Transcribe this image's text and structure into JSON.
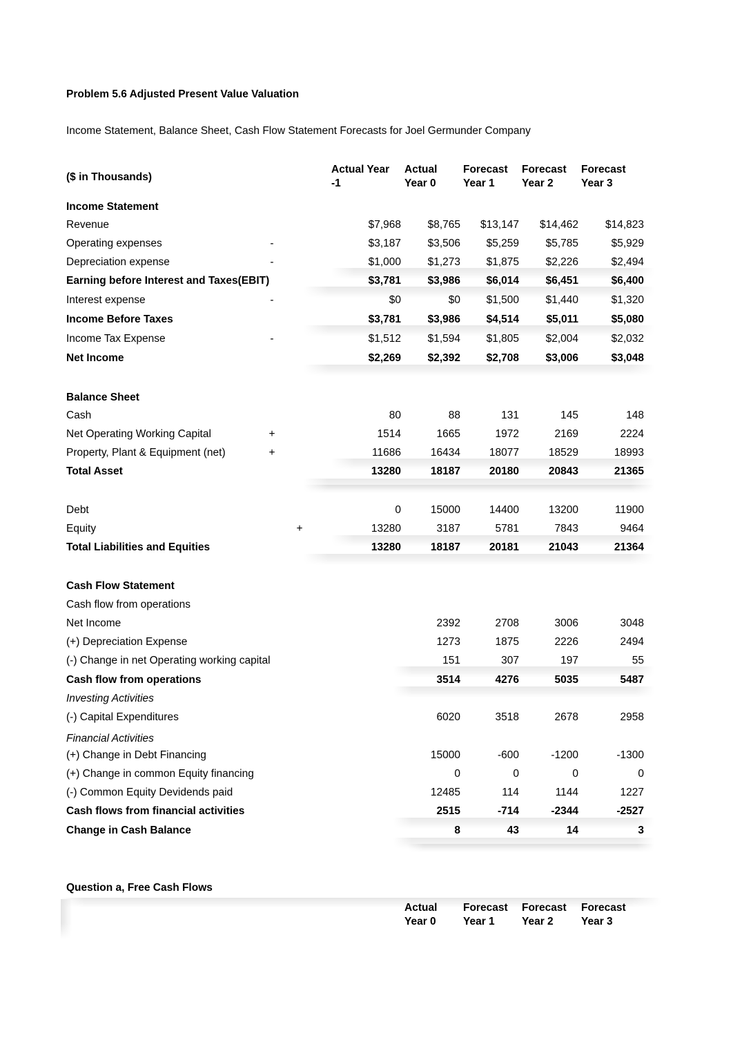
{
  "document": {
    "title": "Problem 5.6 Adjusted Present Value  Valuation",
    "subtitle": "Income Statement, Balance Sheet, Cash Flow Statement Forecasts for Joel Germunder Company",
    "units_label": "($ in Thousands)"
  },
  "column_headers": [
    {
      "top": "Actual Year",
      "bottom": "-1"
    },
    {
      "top": "Actual",
      "bottom": "Year 0"
    },
    {
      "top": "Forecast",
      "bottom": "Year 1"
    },
    {
      "top": "Forecast",
      "bottom": "Year 2"
    },
    {
      "top": "Forecast",
      "bottom": "Year 3"
    }
  ],
  "sections": {
    "income_statement": {
      "heading": "Income Statement",
      "rows": [
        {
          "label": "Revenue",
          "op": "",
          "values": [
            "$7,968",
            "$8,765",
            "$13,147",
            "$14,462",
            "$14,823"
          ],
          "bold": false
        },
        {
          "label": "Operating expenses",
          "op": "-",
          "values": [
            "$3,187",
            "$3,506",
            "$5,259",
            "$5,785",
            "$5,929"
          ],
          "bold": false
        },
        {
          "label": "Depreciation expense",
          "op": "-",
          "values": [
            "$1,000",
            "$1,273",
            "$1,875",
            "$2,226",
            "$2,494"
          ],
          "bold": false
        },
        {
          "label": "Earning before Interest and Taxes(EBIT)",
          "op": "",
          "values": [
            "$3,781",
            "$3,986",
            "$6,014",
            "$6,451",
            "$6,400"
          ],
          "bold": true
        },
        {
          "label": "Interest expense",
          "op": "-",
          "values": [
            "$0",
            "$0",
            "$1,500",
            "$1,440",
            "$1,320"
          ],
          "bold": false
        },
        {
          "label": "Income Before Taxes",
          "op": "",
          "values": [
            "$3,781",
            "$3,986",
            "$4,514",
            "$5,011",
            "$5,080"
          ],
          "bold": true
        },
        {
          "label": "Income Tax Expense",
          "op": "-",
          "values": [
            "$1,512",
            "$1,594",
            "$1,805",
            "$2,004",
            "$2,032"
          ],
          "bold": false
        },
        {
          "label": "Net Income",
          "op": "",
          "values": [
            "$2,269",
            "$2,392",
            "$2,708",
            "$3,006",
            "$3,048"
          ],
          "bold": true
        }
      ]
    },
    "balance_sheet": {
      "heading": "Balance Sheet",
      "rows": [
        {
          "label": "Cash",
          "op": "",
          "values": [
            "80",
            "88",
            "131",
            "145",
            "148"
          ],
          "bold": false
        },
        {
          "label": "Net Operating Working Capital",
          "op": "+",
          "values": [
            "1514",
            "1665",
            "1972",
            "2169",
            "2224"
          ],
          "bold": false
        },
        {
          "label": "Property, Plant & Equipment (net)",
          "op": "+",
          "values": [
            "11686",
            "16434",
            "18077",
            "18529",
            "18993"
          ],
          "bold": false
        },
        {
          "label": "Total Asset",
          "op": "",
          "values": [
            "13280",
            "18187",
            "20180",
            "20843",
            "21365"
          ],
          "bold": true
        },
        {
          "label": "Debt",
          "op": "",
          "values": [
            "0",
            "15000",
            "14400",
            "13200",
            "11900"
          ],
          "bold": false
        },
        {
          "label": "Equity",
          "op": "+",
          "values": [
            "13280",
            "3187",
            "5781",
            "7843",
            "9464"
          ],
          "bold": false
        },
        {
          "label": "Total Liabilities and Equities",
          "op": "",
          "values": [
            "13280",
            "18187",
            "20181",
            "21043",
            "21364"
          ],
          "bold": true
        }
      ]
    },
    "cash_flow_statement": {
      "heading": "Cash Flow Statement",
      "operations_subheading": "Cash flow from operations",
      "investing_subheading": "Investing Activities",
      "financial_subheading": "Financial Activities",
      "rows": [
        {
          "label": "Net Income",
          "values": [
            "2392",
            "2708",
            "3006",
            "3048"
          ],
          "bold": false
        },
        {
          "label": "(+) Depreciation Expense",
          "values": [
            "1273",
            "1875",
            "2226",
            "2494"
          ],
          "bold": false
        },
        {
          "label": "(-) Change in net Operating working capital",
          "values": [
            "151",
            "307",
            "197",
            "55"
          ],
          "bold": false
        },
        {
          "label": "Cash flow from operations",
          "values": [
            "3514",
            "4276",
            "5035",
            "5487"
          ],
          "bold": true
        },
        {
          "label": "(-) Capital Expenditures",
          "values": [
            "6020",
            "3518",
            "2678",
            "2958"
          ],
          "bold": false
        },
        {
          "label": "(+) Change in Debt Financing",
          "values": [
            "15000",
            "-600",
            "-1200",
            "-1300"
          ],
          "bold": false
        },
        {
          "label": "(+) Change in common Equity financing",
          "values": [
            "0",
            "0",
            "0",
            "0"
          ],
          "bold": false
        },
        {
          "label": "(-) Common Equity Devidends paid",
          "values": [
            "12485",
            "114",
            "1144",
            "1227"
          ],
          "bold": false
        },
        {
          "label": "Cash flows from financial activities",
          "values": [
            "2515",
            "-714",
            "-2344",
            "-2527"
          ],
          "bold": true
        },
        {
          "label": "Change in Cash Balance",
          "values": [
            "8",
            "43",
            "14",
            "3"
          ],
          "bold": true
        }
      ]
    },
    "question_a": {
      "heading": "Question a, Free Cash Flows",
      "column_headers": [
        {
          "top": "Actual",
          "bottom": "Year 0"
        },
        {
          "top": "Forecast",
          "bottom": "Year 1"
        },
        {
          "top": "Forecast",
          "bottom": "Year 2"
        },
        {
          "top": "Forecast",
          "bottom": "Year 3"
        }
      ]
    }
  }
}
